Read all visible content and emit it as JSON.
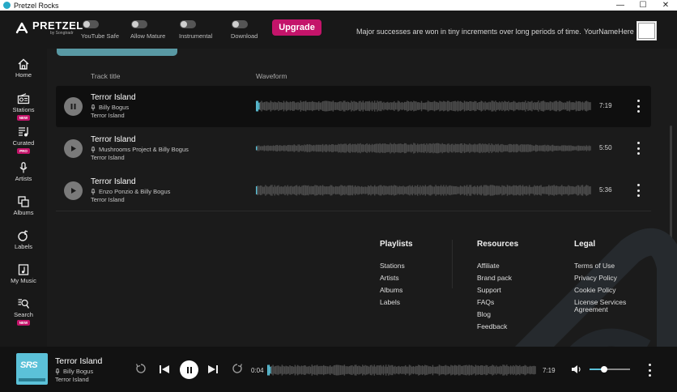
{
  "window": {
    "title": "Pretzel Rocks",
    "minimize": "—",
    "maximize": "☐",
    "close": "✕"
  },
  "header": {
    "brand": "PRETZEL",
    "brand_sub": "by Songtradr",
    "toggles": [
      {
        "label": "YouTube Safe",
        "on": false
      },
      {
        "label": "Allow Mature",
        "on": false
      },
      {
        "label": "Instrumental",
        "on": false
      },
      {
        "label": "Download",
        "on": false
      }
    ],
    "upgrade_label": "Upgrade",
    "motto": "Major successes are won in tiny increments over long periods of time.",
    "username": "YourNameHere"
  },
  "sidebar": {
    "items": [
      {
        "label": "Home",
        "icon": "home-icon",
        "badge": ""
      },
      {
        "label": "Stations",
        "icon": "radio-icon",
        "badge": "NEW"
      },
      {
        "label": "Curated",
        "icon": "curated-icon",
        "badge": "PRO"
      },
      {
        "label": "Artists",
        "icon": "microphone-icon",
        "badge": ""
      },
      {
        "label": "Albums",
        "icon": "albums-icon",
        "badge": ""
      },
      {
        "label": "Labels",
        "icon": "labels-icon",
        "badge": ""
      },
      {
        "label": "My Music",
        "icon": "my-music-icon",
        "badge": ""
      },
      {
        "label": "Search",
        "icon": "search-icon",
        "badge": "NEW"
      }
    ]
  },
  "tracklist": {
    "columns": {
      "title": "Track title",
      "waveform": "Waveform"
    },
    "tracks": [
      {
        "title": "Terror Island",
        "artist": "Billy Bogus",
        "album": "Terror Island",
        "duration": "7:19",
        "playing": true,
        "progress": 0.01
      },
      {
        "title": "Terror Island",
        "artist": "Mushrooms Project & Billy Bogus",
        "album": "Terror Island",
        "duration": "5:50",
        "playing": false,
        "progress": 0
      },
      {
        "title": "Terror Island",
        "artist": "Enzo Ponzio & Billy Bogus",
        "album": "Terror Island",
        "duration": "5:36",
        "playing": false,
        "progress": 0
      }
    ]
  },
  "footer": {
    "playlists": {
      "heading": "Playlists",
      "links": [
        "Stations",
        "Artists",
        "Albums",
        "Labels"
      ]
    },
    "resources": {
      "heading": "Resources",
      "links": [
        "Affiliate",
        "Brand pack",
        "Support",
        "FAQs",
        "Blog",
        "Feedback"
      ]
    },
    "legal": {
      "heading": "Legal",
      "links": [
        "Terms of Use",
        "Privacy Policy",
        "Cookie Policy",
        "License Services Agreement"
      ]
    }
  },
  "player": {
    "title": "Terror Island",
    "artist": "Billy Bogus",
    "album": "Terror Island",
    "cover_text": "SRS",
    "elapsed": "0:04",
    "total": "7:19",
    "progress": 0.01,
    "volume": 0.35,
    "accent": "#5bc1d8"
  }
}
